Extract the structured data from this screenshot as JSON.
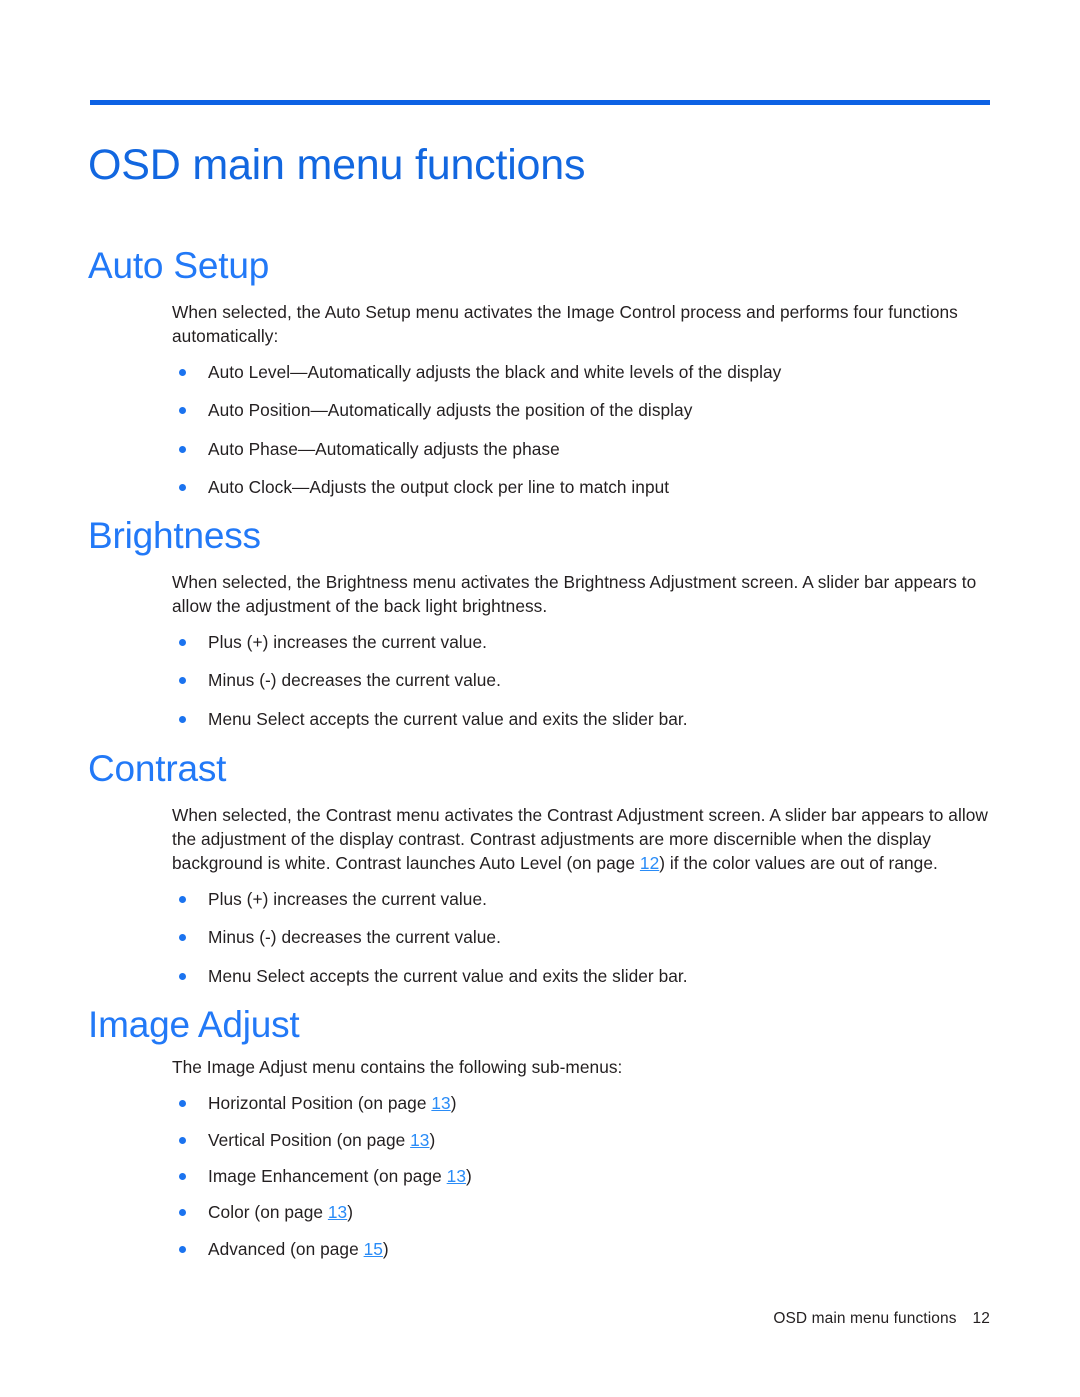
{
  "page": {
    "title": "OSD main menu functions",
    "rule_color": "#0d62e4",
    "title_color": "#1267e0",
    "heading_color": "#2279f7",
    "bullet_color": "#1b73ef",
    "xref_color": "#2a8cf7"
  },
  "sections": {
    "auto_setup": {
      "heading": "Auto Setup",
      "paragraph": "When selected, the Auto Setup menu activates the Image Control process and performs four functions automatically:",
      "bullets": [
        "Auto Level—Automatically adjusts the black and white levels of the display",
        "Auto Position—Automatically adjusts the position of the display",
        "Auto Phase—Automatically adjusts the phase",
        "Auto Clock—Adjusts the output clock per line to match input"
      ]
    },
    "brightness": {
      "heading": "Brightness",
      "paragraph": "When selected, the Brightness menu activates the Brightness Adjustment screen. A slider bar appears to allow the adjustment of the back light brightness.",
      "bullets": [
        "Plus (+) increases the current value.",
        "Minus (-) decreases the current value.",
        "Menu Select accepts the current value and exits the slider bar."
      ]
    },
    "contrast": {
      "heading": "Contrast",
      "paragraph_before_xref": "When selected, the Contrast menu activates the Contrast Adjustment screen. A slider bar appears to allow the adjustment of the display contrast. Contrast adjustments are more discernible when the display background is white. Contrast launches Auto Level (on page ",
      "xref_page": "12",
      "paragraph_after_xref": ") if the color values are out of range.",
      "bullets": [
        "Plus (+) increases the current value.",
        "Minus (-) decreases the current value.",
        "Menu Select accepts the current value and exits the slider bar."
      ]
    },
    "image_adjust": {
      "heading": "Image Adjust",
      "paragraph": "The Image Adjust menu contains the following sub-menus:",
      "bullets": [
        {
          "label_before": "Horizontal Position (on page ",
          "xref_page": "13",
          "label_after": ")"
        },
        {
          "label_before": "Vertical Position (on page ",
          "xref_page": "13",
          "label_after": ")"
        },
        {
          "label_before": "Image Enhancement (on page ",
          "xref_page": "13",
          "label_after": ")"
        },
        {
          "label_before": "Color (on page ",
          "xref_page": "13",
          "label_after": ")"
        },
        {
          "label_before": "Advanced (on page ",
          "xref_page": "15",
          "label_after": ")"
        }
      ]
    }
  },
  "footer": {
    "text": "OSD main menu functions",
    "page_number": "12"
  }
}
